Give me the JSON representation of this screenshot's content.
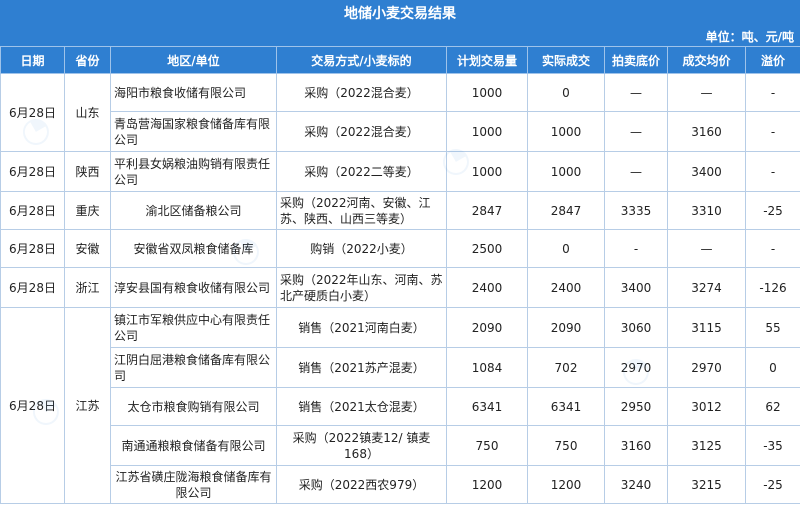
{
  "title": "地储小麦交易结果",
  "unit": "单位：吨、元/吨",
  "headers": [
    "日期",
    "省份",
    "地区/单位",
    "交易方式/小麦标的",
    "计划交易量",
    "实际成交",
    "拍卖底价",
    "成交均价",
    "溢价"
  ],
  "groups": [
    {
      "date": "6月28日",
      "province": "山东",
      "rows": [
        {
          "unit": "海阳市粮食收储有限公司",
          "method": "采购（2022混合麦）",
          "plan": "1000",
          "actual": "0",
          "floor": "—",
          "avg": "—",
          "premium": "-"
        },
        {
          "unit": "青岛营海国家粮食储备库有限公司",
          "method": "采购（2022混合麦）",
          "plan": "1000",
          "actual": "1000",
          "floor": "—",
          "avg": "3160",
          "premium": "-"
        }
      ]
    },
    {
      "date": "6月28日",
      "province": "陕西",
      "rows": [
        {
          "unit": "平利县女娲粮油购销有限责任公司",
          "method": "采购（2022二等麦）",
          "plan": "1000",
          "actual": "1000",
          "floor": "—",
          "avg": "3400",
          "premium": "-"
        }
      ]
    },
    {
      "date": "6月28日",
      "province": "重庆",
      "rows": [
        {
          "unit": "渝北区储备粮公司",
          "method": "采购（2022河南、安徽、江苏、陕西、山西三等麦）",
          "plan": "2847",
          "actual": "2847",
          "floor": "3335",
          "avg": "3310",
          "premium": "-25"
        }
      ]
    },
    {
      "date": "6月28日",
      "province": "安徽",
      "rows": [
        {
          "unit": "安徽省双凤粮食储备库",
          "method": "购销（2022小麦）",
          "plan": "2500",
          "actual": "0",
          "floor": "-",
          "avg": "—",
          "premium": "-"
        }
      ]
    },
    {
      "date": "6月28日",
      "province": "浙江",
      "rows": [
        {
          "unit": "淳安县国有粮食收储有限公司",
          "method": "采购（2022年山东、河南、苏北产硬质白小麦）",
          "plan": "2400",
          "actual": "2400",
          "floor": "3400",
          "avg": "3274",
          "premium": "-126"
        }
      ]
    },
    {
      "date": "6月28日",
      "province": "江苏",
      "rows": [
        {
          "unit": "镇江市军粮供应中心有限责任公司",
          "method": "销售（2021河南白麦）",
          "plan": "2090",
          "actual": "2090",
          "floor": "3060",
          "avg": "3115",
          "premium": "55"
        },
        {
          "unit": "江阴白屈港粮食储备库有限公司",
          "method": "销售（2021苏产混麦）",
          "plan": "1084",
          "actual": "702",
          "floor": "2970",
          "avg": "2970",
          "premium": "0"
        },
        {
          "unit": "太仓市粮食购销有限公司",
          "method": "销售（2021太仓混麦）",
          "plan": "6341",
          "actual": "6341",
          "floor": "2950",
          "avg": "3012",
          "premium": "62"
        },
        {
          "unit": "南通通粮粮食储备有限公司",
          "method": "采购（2022镇麦12/ 镇麦168）",
          "plan": "750",
          "actual": "750",
          "floor": "3160",
          "avg": "3125",
          "premium": "-35"
        },
        {
          "unit": "江苏省磺庄陇海粮食储备库有限公司",
          "method": "采购（2022西农979）",
          "plan": "1200",
          "actual": "1200",
          "floor": "3240",
          "avg": "3215",
          "premium": "-25"
        }
      ]
    }
  ]
}
